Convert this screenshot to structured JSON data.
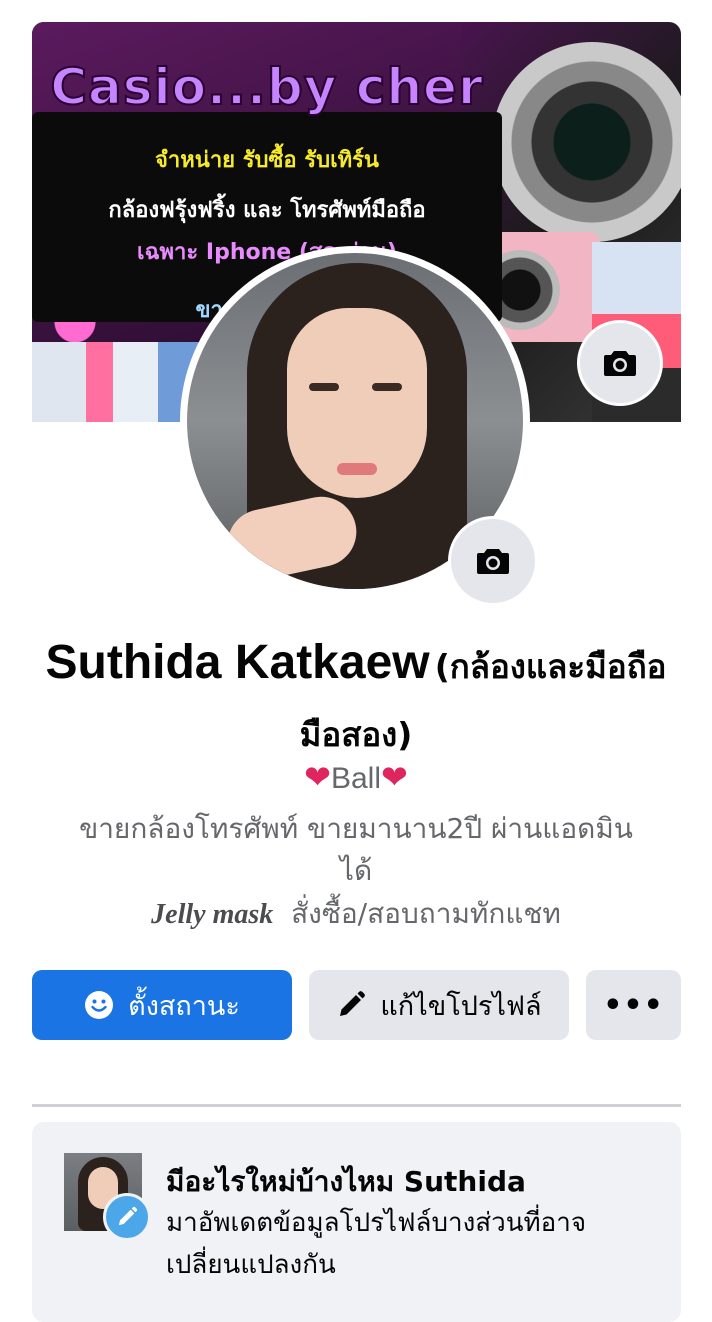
{
  "cover": {
    "title": "Casio...by cher",
    "line1": "จำหน่าย รับซื้อ รับเทิร์น",
    "line2": "กล้องฟรุ้งฟริ้ง และ โทรศัพท์มือถือ",
    "line3": "เฉพาะ Iphone (สด-ผ่อน)",
    "line4": "ขายจริง ส่งจริง",
    "camera_button_icon": "camera-icon"
  },
  "avatar": {
    "camera_button_icon": "camera-icon"
  },
  "profile": {
    "name": "Suthida Katkaew",
    "alt_name": "(กล้องและมือถือมือสอง)",
    "nickname_heart_left": "❤",
    "nickname": "Ball",
    "nickname_heart_right": "❤",
    "bio_line1": "ขายกล้องโทรศัพท์ ขายมานาน2ปี ผ่านแอดมินได้",
    "bio_brand": "Jelly mask",
    "bio_line2": "สั่งซื้อ/สอบถามทักแชท"
  },
  "actions": {
    "status_label": "ตั้งสถานะ",
    "edit_label": "แก้ไขโปรไฟล์",
    "more_label": "•••"
  },
  "prompt_card": {
    "title": "มีอะไรใหม่บ้างไหม Suthida",
    "body": "มาอัพเดตข้อมูลโปรไฟล์บางส่วนที่อาจเปลี่ยนแปลงกัน"
  },
  "colors": {
    "primary": "#1b74e4",
    "secondary_button": "#e4e6eb",
    "muted_text": "#65676b",
    "heart": "#e0245e"
  }
}
